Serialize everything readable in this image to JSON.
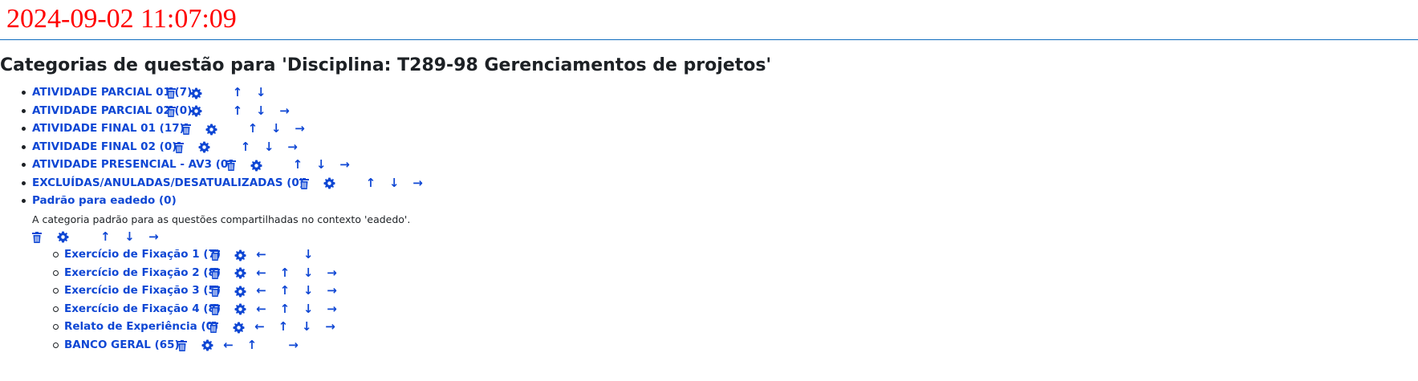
{
  "header": {
    "timestamp": "2024-09-02 11:07:09",
    "title": "Categorias de questão para 'Disciplina: T289-98 Gerenciamentos de projetos'"
  },
  "colors": {
    "timestamp": "#ff0000",
    "link": "#0f47d4",
    "rule": "#0f6cbf"
  },
  "icons": {
    "delete": "trash-icon",
    "edit": "gear-icon",
    "up": "arrow-up-icon",
    "down": "arrow-down-icon",
    "left": "arrow-left-icon",
    "right": "arrow-right-icon"
  },
  "arrows": {
    "up": "↑",
    "down": "↓",
    "left": "←",
    "right": "→"
  },
  "categories": [
    {
      "label": "ATIVIDADE PARCIAL 01 (7)"
    },
    {
      "label": "ATIVIDADE PARCIAL 02 (0)"
    },
    {
      "label": "ATIVIDADE FINAL 01 (17)"
    },
    {
      "label": "ATIVIDADE FINAL 02 (0)"
    },
    {
      "label": "ATIVIDADE PRESENCIAL - AV3 (0)"
    },
    {
      "label": "EXCLUÍDAS/ANULADAS/DESATUALIZADAS (0)"
    },
    {
      "label": "Padrão para eadedo (0)",
      "description": "A categoria padrão para as questões compartilhadas no contexto 'eadedo'."
    }
  ],
  "subcategories": [
    {
      "label": "Exercício de Fixação 1 (7)"
    },
    {
      "label": "Exercício de Fixação 2 (8)"
    },
    {
      "label": "Exercício de Fixação 3 (5)"
    },
    {
      "label": "Exercício de Fixação 4 (8)"
    },
    {
      "label": "Relato de Experiência (0)"
    },
    {
      "label": "BANCO GERAL (65)"
    }
  ]
}
